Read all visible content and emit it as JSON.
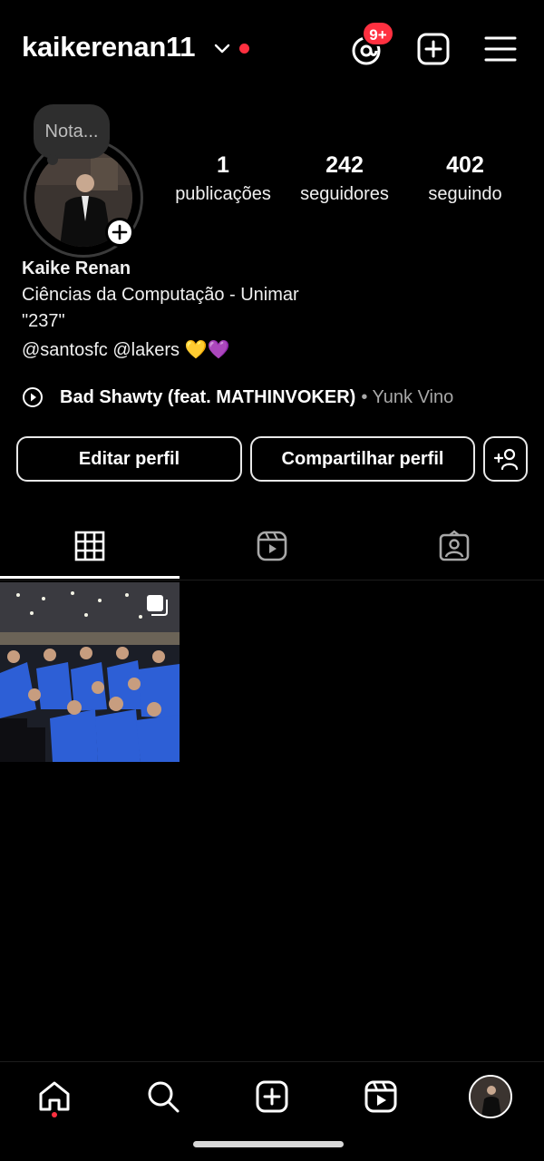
{
  "header": {
    "username": "kaikerenan11",
    "notification_badge": "9+",
    "has_unread_dot": true
  },
  "profile": {
    "note_placeholder": "Nota...",
    "stats": [
      {
        "value": "1",
        "label": "publicações"
      },
      {
        "value": "242",
        "label": "seguidores"
      },
      {
        "value": "402",
        "label": "seguindo"
      }
    ],
    "name": "Kaike Renan",
    "bio_lines": [
      "Ciências da Computação - Unimar",
      "\"237\"",
      "@santosfc @lakers 💛💜"
    ],
    "music": {
      "title": "Bad Shawty (feat. MATHINVOKER)",
      "artist": "• Yunk Vino"
    }
  },
  "actions": {
    "edit_label": "Editar perfil",
    "share_label": "Compartilhar perfil"
  },
  "tabs": [
    {
      "icon": "grid-icon",
      "active": true
    },
    {
      "icon": "reels-icon",
      "active": false
    },
    {
      "icon": "tagged-icon",
      "active": false
    }
  ],
  "posts": [
    {
      "type": "carousel",
      "icon": "multiple-images-icon"
    }
  ],
  "bottom_nav": [
    {
      "icon": "home-icon",
      "active": true
    },
    {
      "icon": "search-icon"
    },
    {
      "icon": "create-icon"
    },
    {
      "icon": "reels-icon"
    },
    {
      "icon": "profile-avatar"
    }
  ],
  "colors": {
    "background": "#000000",
    "accent_red": "#ff3040",
    "secondary_text": "#a8a8a8"
  }
}
